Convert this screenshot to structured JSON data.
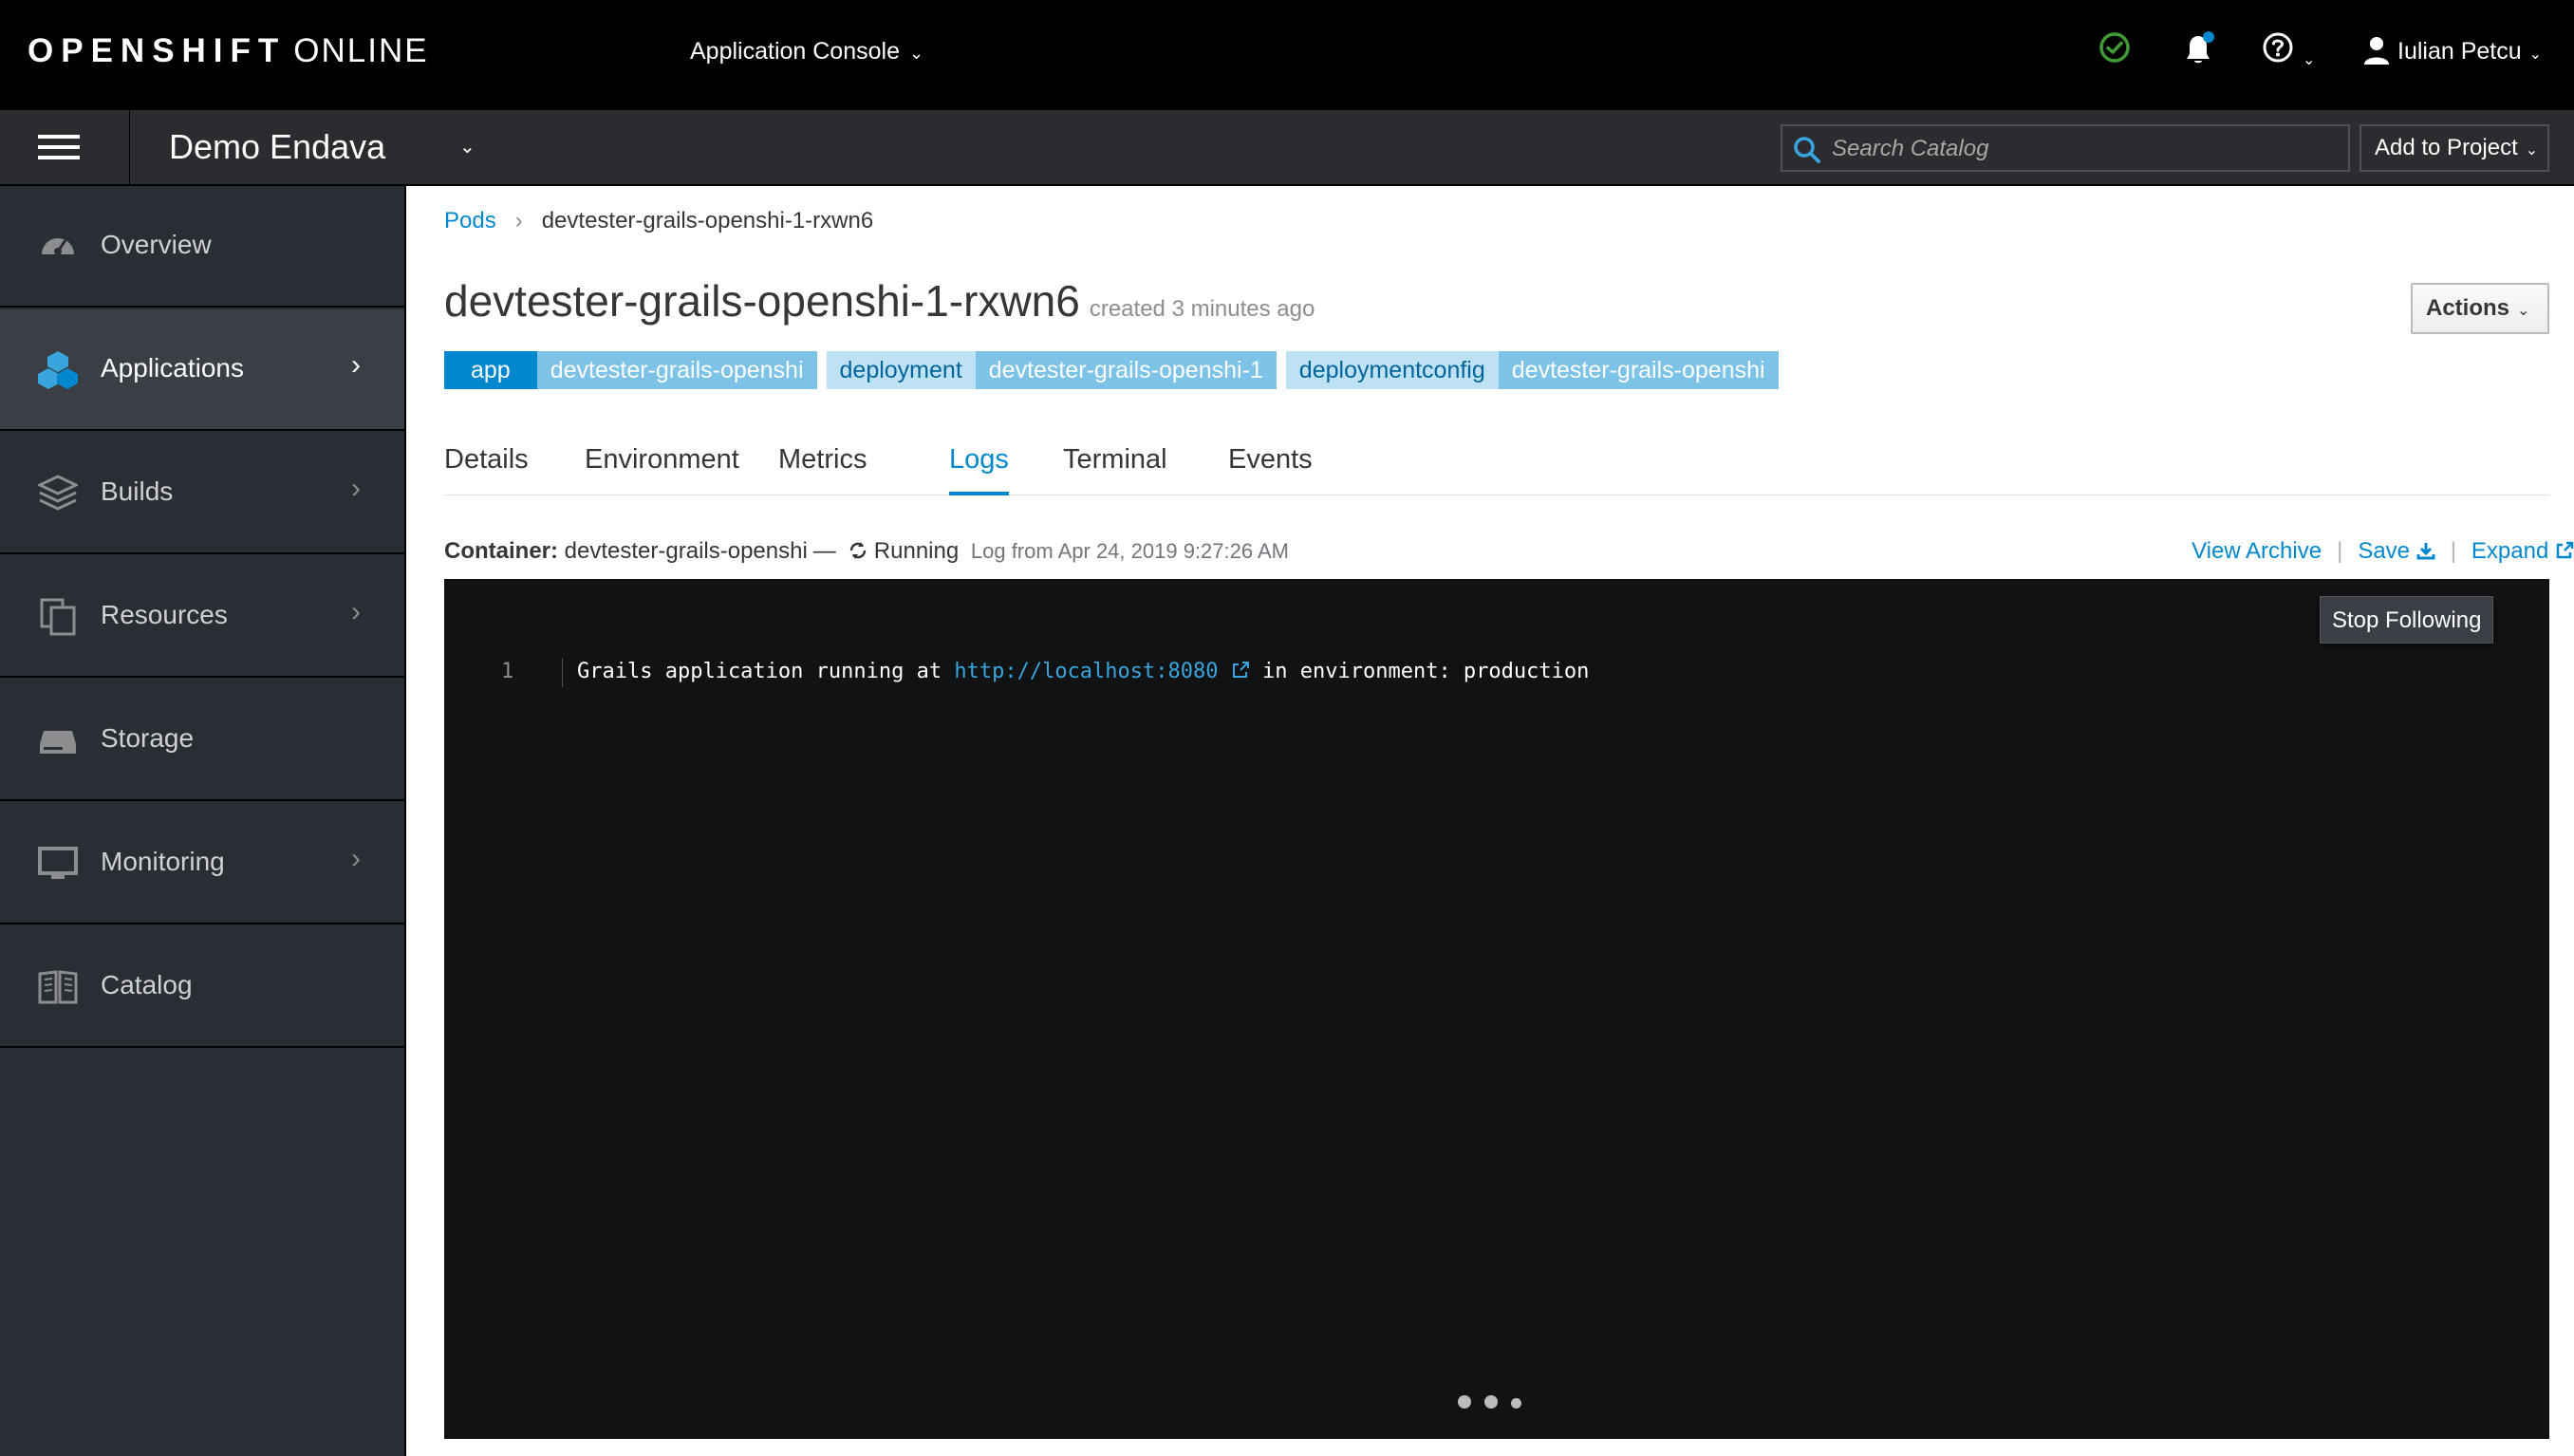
{
  "masthead": {
    "brand_bold": "OPENSHIFT",
    "brand_light": "ONLINE",
    "console_label": "Application Console",
    "user_name": "Iulian Petcu",
    "colors": {
      "status_ok": "#3f9c35",
      "notification_dot": "#0088ce"
    }
  },
  "project": {
    "name": "Demo Endava",
    "search_placeholder": "Search Catalog",
    "add_to_project": "Add to Project"
  },
  "sidebar": {
    "items": [
      {
        "label": "Overview",
        "icon": "dashboard-icon",
        "has_children": false,
        "active": false
      },
      {
        "label": "Applications",
        "icon": "cubes-icon",
        "has_children": true,
        "active": true
      },
      {
        "label": "Builds",
        "icon": "layers-icon",
        "has_children": true,
        "active": false
      },
      {
        "label": "Resources",
        "icon": "files-icon",
        "has_children": true,
        "active": false
      },
      {
        "label": "Storage",
        "icon": "storage-drive-icon",
        "has_children": false,
        "active": false
      },
      {
        "label": "Monitoring",
        "icon": "monitor-icon",
        "has_children": true,
        "active": false
      },
      {
        "label": "Catalog",
        "icon": "book-icon",
        "has_children": false,
        "active": false
      }
    ]
  },
  "breadcrumb": {
    "parent": "Pods",
    "current": "devtester-grails-openshi-1-rxwn6"
  },
  "pod": {
    "name": "devtester-grails-openshi-1-rxwn6",
    "created": "created 3 minutes ago",
    "actions_label": "Actions",
    "labels": [
      {
        "key": "app",
        "value": "devtester-grails-openshi"
      },
      {
        "key": "deployment",
        "value": "devtester-grails-openshi-1"
      },
      {
        "key": "deploymentconfig",
        "value": "devtester-grails-openshi"
      }
    ]
  },
  "tabs": [
    "Details",
    "Environment",
    "Metrics",
    "Logs",
    "Terminal",
    "Events"
  ],
  "active_tab": "Logs",
  "logs": {
    "container_label": "Container:",
    "container_name": "devtester-grails-openshi",
    "dash": "—",
    "status": "Running",
    "log_from": "Log from Apr 24, 2019 9:27:26 AM",
    "view_archive": "View Archive",
    "save": "Save",
    "expand": "Expand",
    "stop_following": "Stop Following",
    "lines": [
      {
        "num": "1",
        "text_before": "Grails application running at ",
        "link": "http://localhost:8080",
        "text_after": " in environment: production"
      }
    ]
  }
}
